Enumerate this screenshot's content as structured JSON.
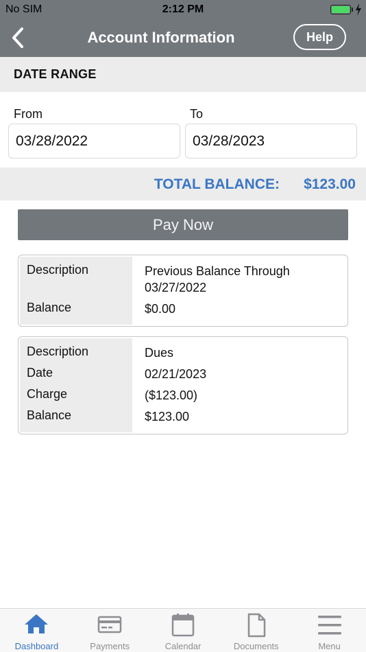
{
  "status_bar": {
    "carrier": "No SIM",
    "time": "2:12 PM",
    "battery_level": 1.0
  },
  "nav": {
    "title": "Account Information",
    "help_label": "Help",
    "back_icon": "chevron-left-icon"
  },
  "date_range": {
    "header": "DATE RANGE",
    "from_label": "From",
    "from_value": "03/28/2022",
    "to_label": "To",
    "to_value": "03/28/2023"
  },
  "summary": {
    "total_label": "TOTAL BALANCE:",
    "total_value": "$123.00",
    "accent_color": "#3a76c4"
  },
  "pay_now_label": "Pay Now",
  "transactions": [
    {
      "rows": [
        {
          "key": "Description",
          "value": "Previous Balance Through 03/27/2022"
        },
        {
          "key": "Balance",
          "value": "$0.00"
        }
      ]
    },
    {
      "rows": [
        {
          "key": "Description",
          "value": "Dues"
        },
        {
          "key": "Date",
          "value": "02/21/2023"
        },
        {
          "key": "Charge",
          "value": "($123.00)"
        },
        {
          "key": "Balance",
          "value": "$123.00"
        }
      ]
    }
  ],
  "tabs": [
    {
      "label": "Dashboard",
      "icon": "home-icon",
      "active": true
    },
    {
      "label": "Payments",
      "icon": "credit-card-icon",
      "active": false
    },
    {
      "label": "Calendar",
      "icon": "calendar-icon",
      "active": false
    },
    {
      "label": "Documents",
      "icon": "document-icon",
      "active": false
    },
    {
      "label": "Menu",
      "icon": "menu-icon",
      "active": false
    }
  ]
}
